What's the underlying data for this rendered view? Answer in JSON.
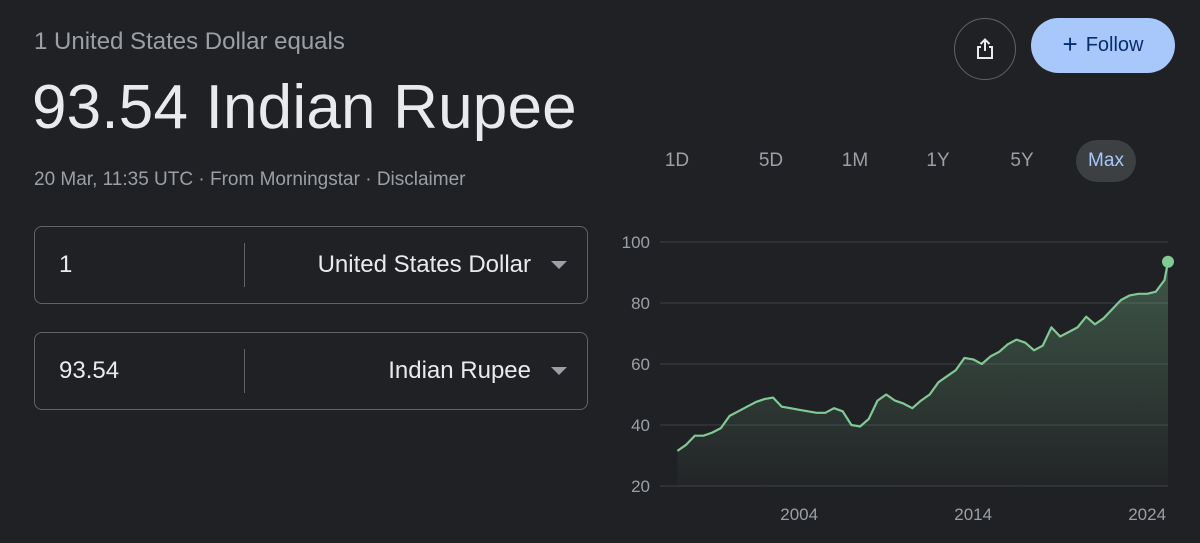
{
  "header": {
    "subtitle": "1 United States Dollar equals",
    "rate": "93.54 Indian Rupee",
    "timestamp": "20 Mar, 11:35 UTC",
    "separator": "·",
    "source": "From Morningstar",
    "disclaimer": "Disclaimer"
  },
  "actions": {
    "share_icon": "share-icon",
    "follow_label": "Follow",
    "follow_icon": "plus-icon"
  },
  "converter": {
    "from": {
      "amount": "1",
      "currency": "United States Dollar"
    },
    "to": {
      "amount": "93.54",
      "currency": "Indian Rupee"
    }
  },
  "ranges": [
    "1D",
    "5D",
    "1M",
    "1Y",
    "5Y",
    "Max"
  ],
  "selected_range": "Max",
  "colors": {
    "background": "#202124",
    "line": "#81c995",
    "accent": "#a8c7fa",
    "grid": "#3c4043"
  },
  "chart_data": {
    "type": "area",
    "title": "",
    "xlabel": "",
    "ylabel": "",
    "ylim": [
      20,
      100
    ],
    "xlim": [
      1996,
      2025.2
    ],
    "yticks": [
      20,
      40,
      60,
      80,
      100
    ],
    "xticks": [
      "2004",
      "2014",
      "2024"
    ],
    "xtick_values": [
      2004,
      2014,
      2024
    ],
    "grid": true,
    "series": [
      {
        "x": [
          1997.0,
          1997.5,
          1998.0,
          1998.5,
          1999.0,
          1999.5,
          2000.0,
          2000.5,
          2001.0,
          2001.5,
          2002.0,
          2002.5,
          2003.0,
          2003.5,
          2004.0,
          2004.5,
          2005.0,
          2005.5,
          2006.0,
          2006.5,
          2007.0,
          2007.5,
          2008.0,
          2008.5,
          2009.0,
          2009.5,
          2010.0,
          2010.5,
          2011.0,
          2011.5,
          2012.0,
          2012.5,
          2013.0,
          2013.5,
          2014.0,
          2014.5,
          2015.0,
          2015.5,
          2016.0,
          2016.5,
          2017.0,
          2017.5,
          2018.0,
          2018.5,
          2019.0,
          2019.5,
          2020.0,
          2020.5,
          2021.0,
          2021.5,
          2022.0,
          2022.5,
          2023.0,
          2023.5,
          2024.0,
          2024.5,
          2025.0,
          2025.2
        ],
        "values": [
          31.5,
          33.5,
          36.5,
          36.5,
          37.5,
          39,
          43,
          44.5,
          46,
          47.5,
          48.5,
          49,
          46,
          45.5,
          45,
          44.5,
          44,
          44,
          45.5,
          44.5,
          40,
          39.5,
          42,
          48,
          50,
          48,
          47,
          45.5,
          48,
          50,
          54,
          56,
          58,
          62,
          61.5,
          60,
          62.5,
          64,
          66.5,
          68,
          67,
          64.5,
          66,
          72,
          69,
          70.5,
          72,
          75.5,
          73,
          75,
          78,
          81,
          82.5,
          83,
          83,
          83.7,
          87.5,
          93.54
        ]
      }
    ],
    "last_point_marker": true
  }
}
